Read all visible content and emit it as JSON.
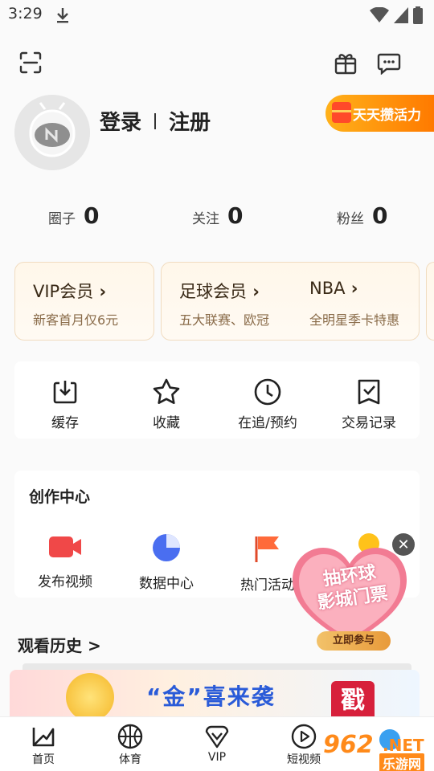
{
  "status_bar": {
    "time": "3:29"
  },
  "profile": {
    "login_label": "登录",
    "register_label": "注册",
    "activity_badge": "天天攒活力"
  },
  "stats": [
    {
      "label": "圈子",
      "value": "0"
    },
    {
      "label": "关注",
      "value": "0"
    },
    {
      "label": "粉丝",
      "value": "0"
    }
  ],
  "memberships": [
    {
      "title": "VIP会员",
      "subtitle": "新客首月仅6元"
    },
    {
      "title": "足球会员",
      "subtitle": "五大联赛、欧冠"
    },
    {
      "title": "NBA",
      "subtitle": "全明星季卡特惠"
    }
  ],
  "quick_actions": [
    {
      "label": "缓存",
      "icon": "download-icon"
    },
    {
      "label": "收藏",
      "icon": "star-icon"
    },
    {
      "label": "在追/预约",
      "icon": "clock-icon"
    },
    {
      "label": "交易记录",
      "icon": "receipt-icon"
    }
  ],
  "creator_center": {
    "title": "创作中心",
    "items": [
      {
        "label": "发布视频",
        "icon": "video-camera-icon"
      },
      {
        "label": "数据中心",
        "icon": "pie-chart-icon"
      },
      {
        "label": "热门活动",
        "icon": "flag-icon"
      }
    ]
  },
  "promo": {
    "line1": "抽环球",
    "line2": "影城门票",
    "cta": "立即参与"
  },
  "history": {
    "title": "观看历史 >"
  },
  "banner": {
    "text": "“金”喜来袭",
    "stamp": "戳"
  },
  "bottom_nav": [
    {
      "label": "首页",
      "icon": "home-icon"
    },
    {
      "label": "体育",
      "icon": "basketball-icon"
    },
    {
      "label": "VIP",
      "icon": "vip-icon"
    },
    {
      "label": "短视频",
      "icon": "play-icon"
    }
  ],
  "watermark": {
    "text1": "962",
    "text2": ".NET",
    "text3": "乐游网"
  },
  "colors": {
    "accent_orange": "#ff7a00",
    "vip_card_bg": "#fff7ea",
    "video_red": "#f04848",
    "chart_blue": "#4a6ef0",
    "flag_orange": "#ff6a3a"
  }
}
